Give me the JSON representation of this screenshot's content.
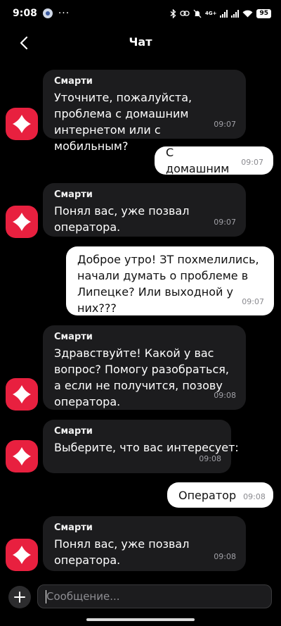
{
  "status_bar": {
    "time": "9:08",
    "more": "···",
    "network": "4G+",
    "battery": "95"
  },
  "header": {
    "title": "Чат"
  },
  "messages": [
    {
      "sender": "Смарти",
      "text": "Уточните, пожалуйста, проблема с домашним интернетом или с мобильным?",
      "time": "09:07"
    },
    {
      "text": "С домашним",
      "time": "09:07"
    },
    {
      "sender": "Смарти",
      "text": "Понял вас, уже позвал оператора.",
      "time": "09:07"
    },
    {
      "text": "Доброе утро! ЗТ похмелились, начали думать о проблеме в Липецке? Или выходной у них???",
      "time": "09:07"
    },
    {
      "sender": "Смарти",
      "text": "Здравствуйте! Какой у вас вопрос? Помогу разобраться, а если не получится, позову оператора.",
      "time": "09:08"
    },
    {
      "sender": "Смарти",
      "text": "Выберите, что вас интересует:",
      "time": "09:08"
    },
    {
      "text": "Оператор",
      "time": "09:08"
    },
    {
      "sender": "Смарти",
      "text": "Понял вас, уже позвал оператора.",
      "time": "09:08"
    }
  ],
  "composer": {
    "placeholder": "Сообщение..."
  },
  "colors": {
    "avatar": "#e8203f",
    "bot_bubble": "#1c1c1e",
    "user_bubble": "#ffffff"
  }
}
